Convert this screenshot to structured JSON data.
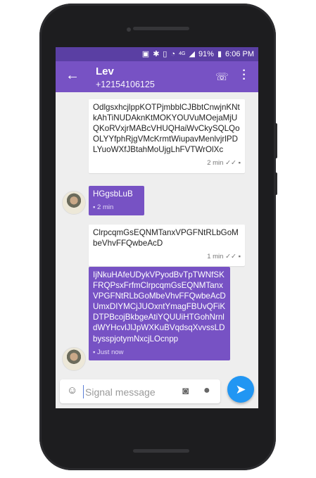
{
  "status": {
    "time": "6:06 PM",
    "battery": "91%",
    "network": "4G",
    "icons": [
      "sd-card-icon",
      "bluetooth-icon",
      "vibrate-icon",
      "wifi-icon",
      "signal-icon",
      "battery-icon"
    ]
  },
  "header": {
    "name": "Lev",
    "phone": "+12154106125",
    "back_icon": "arrow-back-icon",
    "call_icon": "phone-call-icon",
    "more_icon": "more-vert-icon"
  },
  "messages": [
    {
      "direction": "outgoing",
      "text": "OdlgsxhcjlppKOTPjmbblCJBbtCnwjnKNtkAhTiNUDAknKtMOKYOUVuMOejaMjUQKoRVxjrMABcVHUQHaiWvCkySQLQoOLYYfphRjgVMcKrmtWiupavMenlvjrlPDLYuoWXfJBtahMoUjgLhFVTWrOlXc",
      "time": "2 min",
      "status": "delivered"
    },
    {
      "direction": "incoming",
      "text": "HGgsbLuB",
      "time": "2 min"
    },
    {
      "direction": "outgoing",
      "text": "ClrpcqmGsEQNMTanxVPGFNtRLbGoMbeVhvFFQwbeAcD",
      "time": "1 min",
      "status": "delivered"
    },
    {
      "direction": "incoming",
      "text": "IjNkuHAfeUDykVPyodBvTpTWNfSKFRQPsxFrfmClrpcqmGsEQNMTanxVPGFNtRLbGoMbeVhvFFQwbeAcDUmxDIYMCjJUOxntYmagFBUvQFiKDTPBcojBkbgeAtiYQUUiHTGohNrnldWYHcvlJlJpWXKuBVqdsqXvvssLDbysspjotymNxcjLOcnpp",
      "time": "Just now"
    }
  ],
  "composer": {
    "placeholder": "Signal message",
    "emoji_icon": "emoji-icon",
    "camera_icon": "camera-icon",
    "mic_icon": "mic-icon",
    "send_icon": "send-icon"
  },
  "colors": {
    "accent": "#7752c4",
    "statusbar": "#5a3fa3",
    "send": "#2196f3",
    "bubble_out": "#ffffff",
    "background": "#eeeeee"
  }
}
